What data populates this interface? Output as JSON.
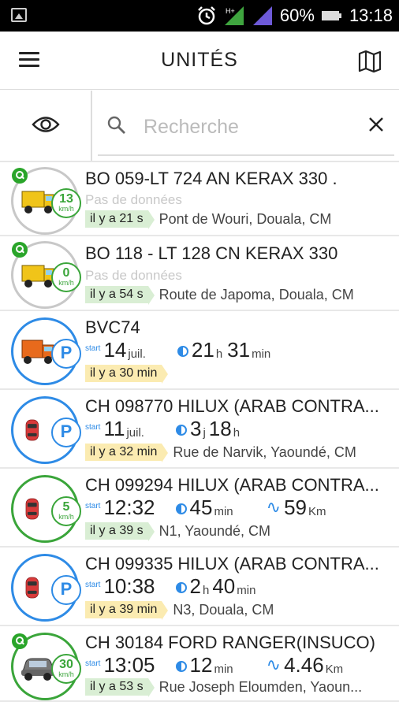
{
  "status_bar": {
    "battery": "60%",
    "time": "13:18",
    "icons": [
      "image-icon",
      "alarm-icon",
      "signal-h-icon",
      "signal-icon",
      "battery-icon"
    ]
  },
  "app_bar": {
    "title": "UNITÉS",
    "menu_icon": "menu-icon",
    "map_icon": "map-icon"
  },
  "search": {
    "placeholder": "Recherche",
    "value": "",
    "visibility_icon": "eye-icon",
    "search_icon": "search-icon",
    "clear_icon": "close-icon"
  },
  "units": [
    {
      "name": "BO 059-LT 724 AN KERAX 330 .",
      "vehicle": "truck-yellow",
      "ring_color": "#c8c8c8",
      "key": true,
      "speed": "13",
      "speed_unit": "km/h",
      "nodata": "Pas de données",
      "ago": "il y a 21 s",
      "ago_color": "green",
      "address": "Pont de Wouri, Douala, CM"
    },
    {
      "name": "BO 118 - LT 128 CN  KERAX 330",
      "vehicle": "truck-yellow",
      "ring_color": "#c8c8c8",
      "key": true,
      "speed": "0",
      "speed_unit": "km/h",
      "nodata": "Pas de données",
      "ago": "il y a 54 s",
      "ago_color": "green",
      "address": "Route de Japoma, Douala, CM"
    },
    {
      "name": "BVC74",
      "vehicle": "truck-orange",
      "ring_color": "#2e8be6",
      "parked": true,
      "start_label": "start",
      "start_big": "14",
      "start_small": "juil.",
      "dur_big1": "21",
      "dur_small1": "h",
      "dur_big2": "31",
      "dur_small2": "min",
      "ago": "il y a 30 min",
      "ago_color": "yellow",
      "address": ""
    },
    {
      "name": "CH 098770 HILUX (ARAB CONTRA...",
      "vehicle": "car-red",
      "ring_color": "#2e8be6",
      "parked": true,
      "start_label": "start",
      "start_big": "11",
      "start_small": "juil.",
      "dur_big1": "3",
      "dur_small1": "j",
      "dur_big2": "18",
      "dur_small2": "h",
      "ago": "il y a 32 min",
      "ago_color": "yellow",
      "address": "Rue de Narvik, Yaoundé, CM"
    },
    {
      "name": "CH 099294 HILUX (ARAB CONTRA...",
      "vehicle": "car-red",
      "ring_color": "#3aa53a",
      "speed": "5",
      "speed_unit": "km/h",
      "start_label": "start",
      "start_big": "12:32",
      "dur_big1": "45",
      "dur_small1": "min",
      "dist_big": "59",
      "dist_small": "Km",
      "ago": "il y a 39 s",
      "ago_color": "green",
      "address": "N1, Yaoundé, CM"
    },
    {
      "name": "CH 099335 HILUX (ARAB CONTRA...",
      "vehicle": "car-red",
      "ring_color": "#2e8be6",
      "parked": true,
      "start_label": "start",
      "start_big": "10:38",
      "dur_big1": "2",
      "dur_small1": "h",
      "dur_big2": "40",
      "dur_small2": "min",
      "ago": "il y a 39 min",
      "ago_color": "yellow",
      "address": "N3, Douala, CM"
    },
    {
      "name": "CH 30184 FORD RANGER(INSUCO)",
      "vehicle": "car-gray",
      "ring_color": "#3aa53a",
      "key": true,
      "speed": "30",
      "speed_unit": "km/h",
      "start_label": "start",
      "start_big": "13:05",
      "dur_big1": "12",
      "dur_small1": "min",
      "dist_big": "4.46",
      "dist_small": "Km",
      "ago": "il y a 53 s",
      "ago_color": "green",
      "address": "Rue Joseph Eloumden, Yaoun..."
    }
  ]
}
